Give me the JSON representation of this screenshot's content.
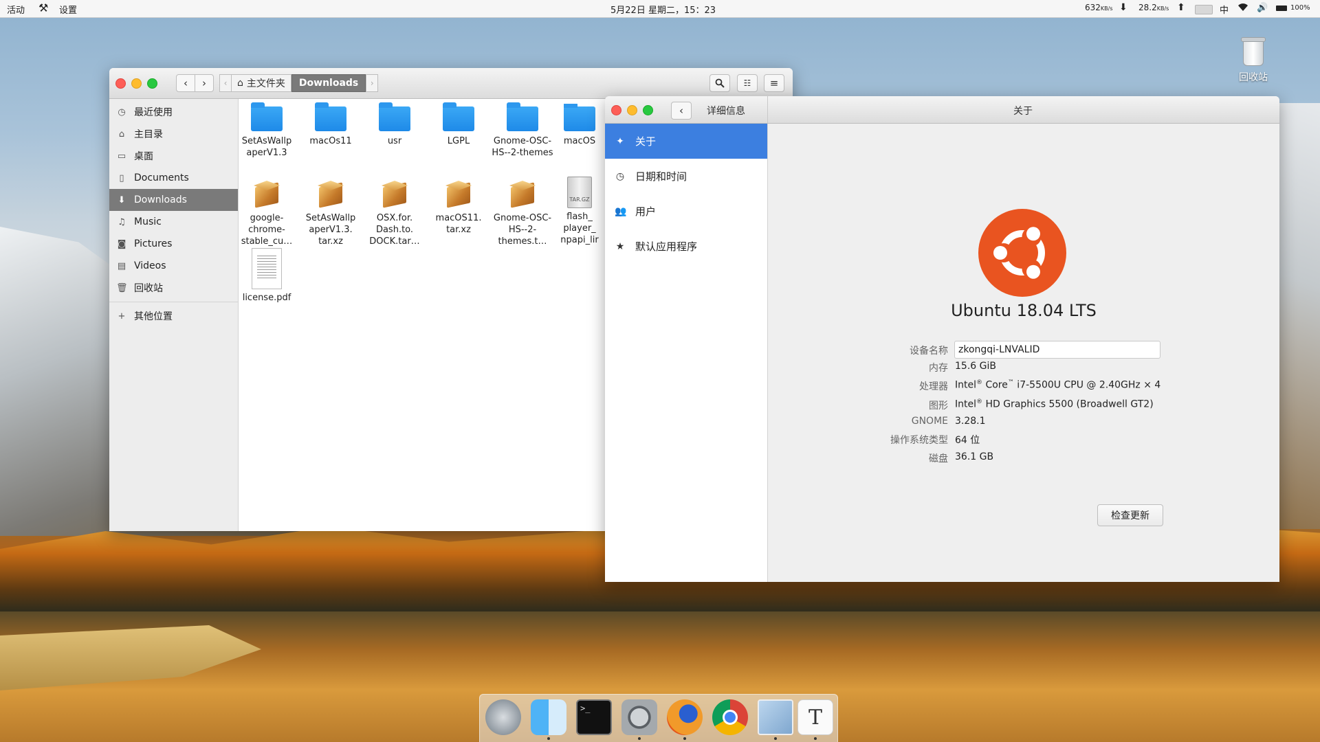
{
  "topbar": {
    "activities": "活动",
    "settings_app": "设置",
    "clock": "5月22日 星期二，15：23",
    "net_down": "632",
    "net_down_unit": "KB/s",
    "net_up": "28.2",
    "net_up_unit": "KB/s",
    "ime": "中",
    "battery": "100%"
  },
  "desktop": {
    "trash_label": "回收站"
  },
  "files_window": {
    "path_home": "主文件夹",
    "path_current": "Downloads",
    "sidebar": [
      {
        "label": "最近使用",
        "icon": "clock-icon"
      },
      {
        "label": "主目录",
        "icon": "home-icon"
      },
      {
        "label": "桌面",
        "icon": "desktop-icon"
      },
      {
        "label": "Documents",
        "icon": "document-icon"
      },
      {
        "label": "Downloads",
        "icon": "download-icon",
        "active": true
      },
      {
        "label": "Music",
        "icon": "music-icon"
      },
      {
        "label": "Pictures",
        "icon": "camera-icon"
      },
      {
        "label": "Videos",
        "icon": "video-icon"
      },
      {
        "label": "回收站",
        "icon": "trash-icon"
      },
      {
        "label": "其他位置",
        "icon": "plus-icon"
      }
    ],
    "items": [
      {
        "name": "SetAsWallp aperV1.3",
        "type": "folder"
      },
      {
        "name": "macOs11",
        "type": "folder"
      },
      {
        "name": "usr",
        "type": "folder"
      },
      {
        "name": "LGPL",
        "type": "folder"
      },
      {
        "name": "Gnome-OSC-HS--2-themes",
        "type": "folder"
      },
      {
        "name": "macOS",
        "type": "folder"
      },
      {
        "name": "google-chrome-stable_cu…",
        "type": "package"
      },
      {
        "name": "SetAsWallp aperV1.3. tar.xz",
        "type": "package"
      },
      {
        "name": "OSX.for. Dash.to. DOCK.tar…",
        "type": "package"
      },
      {
        "name": "macOS11. tar.xz",
        "type": "package"
      },
      {
        "name": "Gnome-OSC-HS--2-themes.t…",
        "type": "package"
      },
      {
        "name": "flash_ player_ npapi_lir",
        "type": "tgz"
      },
      {
        "name": "license.pdf",
        "type": "pdf"
      }
    ],
    "tgz_badge": "TAR.GZ"
  },
  "settings_window": {
    "left_title": "详细信息",
    "right_title": "关于",
    "sidebar": [
      {
        "label": "关于",
        "icon": "sparkle-icon",
        "active": true
      },
      {
        "label": "日期和时间",
        "icon": "clock-icon"
      },
      {
        "label": "用户",
        "icon": "users-icon"
      },
      {
        "label": "默认应用程序",
        "icon": "star-icon"
      }
    ],
    "os_name": "Ubuntu 18.04 LTS",
    "labels": {
      "device_name": "设备名称",
      "memory": "内存",
      "processor": "处理器",
      "graphics": "图形",
      "gnome": "GNOME",
      "os_type": "操作系统类型",
      "disk": "磁盘"
    },
    "values": {
      "device_name": "zkongqi-LNVALID",
      "memory": "15.6 GiB",
      "processor_brand": "Intel",
      "processor_core": "Core",
      "processor_rest": " i7-5500U CPU @ 2.40GHz × 4",
      "graphics_brand": "Intel",
      "graphics_rest": " HD Graphics 5500 (Broadwell GT2)",
      "gnome": "3.28.1",
      "os_type": "64 位",
      "disk": "36.1 GB"
    },
    "check_updates": "检查更新",
    "colors": {
      "accent": "#3c7fe0",
      "ubuntu_orange": "#e95420"
    }
  },
  "dock": {
    "apps": [
      "launchpad-icon",
      "finder-icon",
      "terminal-icon",
      "system-preferences-icon",
      "firefox-icon",
      "chrome-icon",
      "preview-icon",
      "typora-icon"
    ],
    "terminal_glyph": ">_",
    "typora_glyph": "T"
  }
}
